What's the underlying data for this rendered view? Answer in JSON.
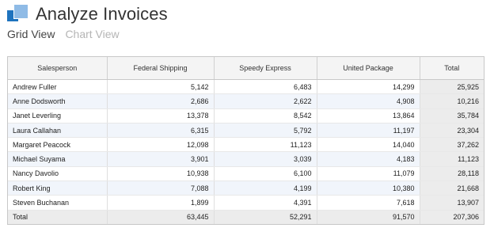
{
  "app": {
    "title": "Analyze Invoices"
  },
  "tabs": [
    {
      "label": "Grid View",
      "active": true
    },
    {
      "label": "Chart View",
      "active": false
    }
  ],
  "grid": {
    "columns": [
      "Salesperson",
      "Federal Shipping",
      "Speedy Express",
      "United Package",
      "Total"
    ],
    "rows": [
      [
        "Andrew Fuller",
        "5,142",
        "6,483",
        "14,299",
        "25,925"
      ],
      [
        "Anne Dodsworth",
        "2,686",
        "2,622",
        "4,908",
        "10,216"
      ],
      [
        "Janet Leverling",
        "13,378",
        "8,542",
        "13,864",
        "35,784"
      ],
      [
        "Laura Callahan",
        "6,315",
        "5,792",
        "11,197",
        "23,304"
      ],
      [
        "Margaret Peacock",
        "12,098",
        "11,123",
        "14,040",
        "37,262"
      ],
      [
        "Michael Suyama",
        "3,901",
        "3,039",
        "4,183",
        "11,123"
      ],
      [
        "Nancy Davolio",
        "10,938",
        "6,100",
        "11,079",
        "28,118"
      ],
      [
        "Robert King",
        "7,088",
        "4,199",
        "10,380",
        "21,668"
      ],
      [
        "Steven Buchanan",
        "1,899",
        "4,391",
        "7,618",
        "13,907"
      ]
    ],
    "total_row": [
      "Total",
      "63,445",
      "52,291",
      "91,570",
      "207,306"
    ]
  },
  "colors": {
    "accent": "#1e73be",
    "accent_light": "#8fbbe6",
    "alt_row": "#f1f5fb",
    "total_bg": "#ececec"
  },
  "icons": {
    "logo": "app-logo-icon"
  }
}
